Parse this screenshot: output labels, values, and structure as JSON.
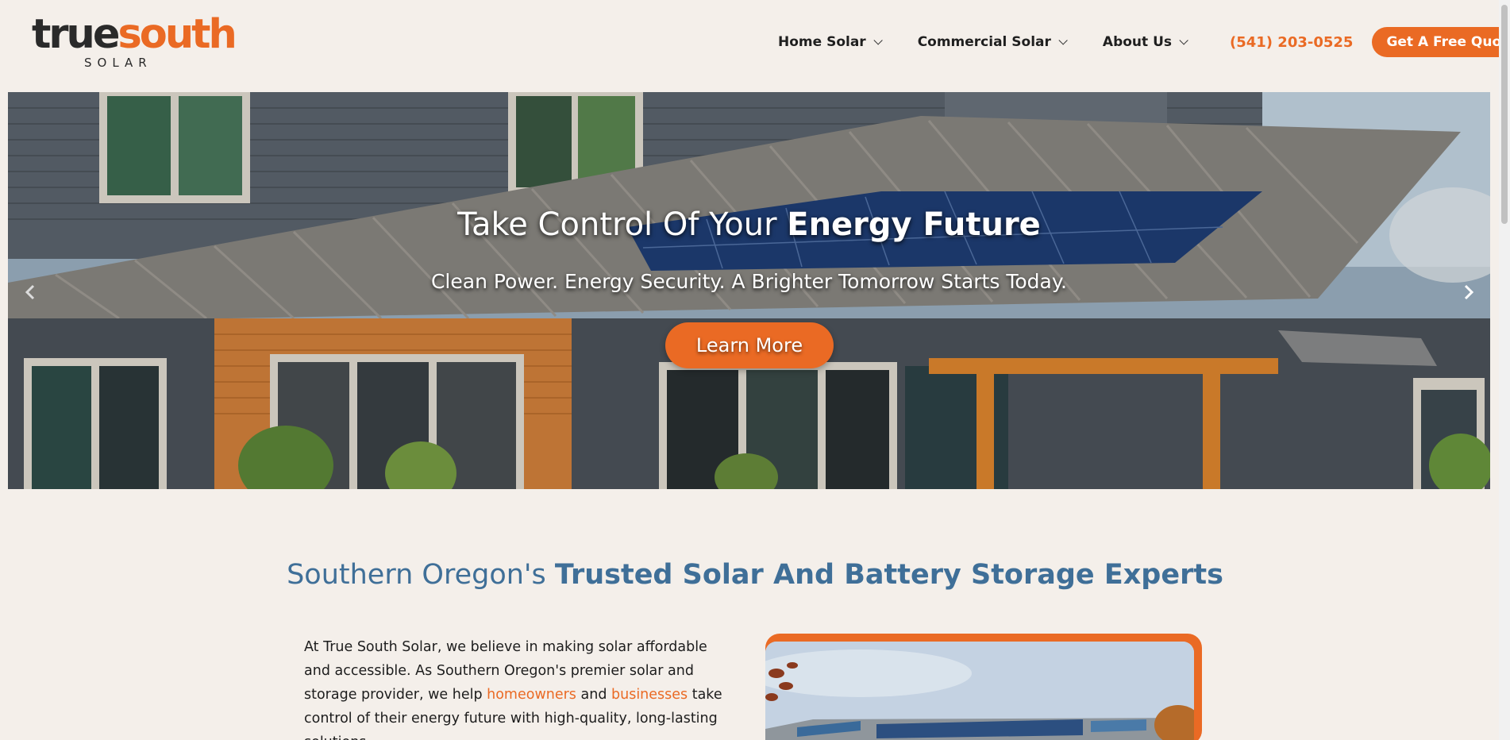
{
  "brand": {
    "logo_primary": "true",
    "logo_accent": "south",
    "logo_sub": "SOLAR",
    "accent_color": "#ea6a24",
    "heading_color": "#3f6f98"
  },
  "nav": {
    "items": [
      {
        "label": "Home Solar",
        "icon": "chevron-down-icon"
      },
      {
        "label": "Commercial Solar",
        "icon": "chevron-down-icon"
      },
      {
        "label": "About Us",
        "icon": "chevron-down-icon"
      }
    ],
    "phone": "(541) 203-0525",
    "cta": "Get A Free Quote"
  },
  "hero": {
    "title_normal": "Take Control Of Your ",
    "title_bold": "Energy Future",
    "subtitle": "Clean Power. Energy Security. A Brighter Tomorrow Starts Today.",
    "button": "Learn More",
    "prev_icon": "chevron-left-icon",
    "next_icon": "chevron-right-icon"
  },
  "section": {
    "heading_normal": "Southern Oregon's ",
    "heading_bold": "Trusted Solar And Battery Storage Experts",
    "intro_part1": "At True South Solar, we believe in making solar affordable and accessible. As Southern Oregon's premier solar and storage provider, we help ",
    "link_homeowners": "homeowners",
    "intro_and": " and ",
    "link_businesses": "businesses",
    "intro_part2": " take control of their energy future with high-quality, long-lasting solutions."
  }
}
